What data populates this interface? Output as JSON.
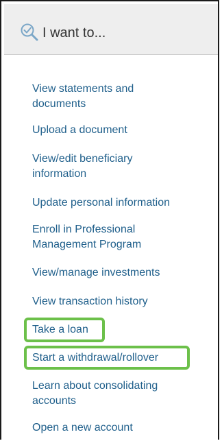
{
  "panel": {
    "title": "I want to...",
    "header_icon": "magnifier-check-icon",
    "links": [
      {
        "label_line1": "View statements and",
        "label_line2": "documents"
      },
      {
        "label_line1": "Upload a document"
      },
      {
        "label_line1": "View/edit beneficiary",
        "label_line2": "information"
      },
      {
        "label_line1": "Update personal information"
      },
      {
        "label_line1": "Enroll in Professional",
        "label_line2": "Management Program"
      },
      {
        "label_line1": "View/manage investments"
      },
      {
        "label_line1": "View transaction history"
      },
      {
        "label_line1": "Take a loan"
      },
      {
        "label_line1": "Start a withdrawal/rollover"
      },
      {
        "label_line1": "Learn about consolidating",
        "label_line2": "accounts"
      },
      {
        "label_line1": "Open a new account"
      }
    ]
  },
  "colors": {
    "link": "#1f5f8b",
    "highlight": "#6cc04a",
    "header_bg": "#eeeeee"
  }
}
